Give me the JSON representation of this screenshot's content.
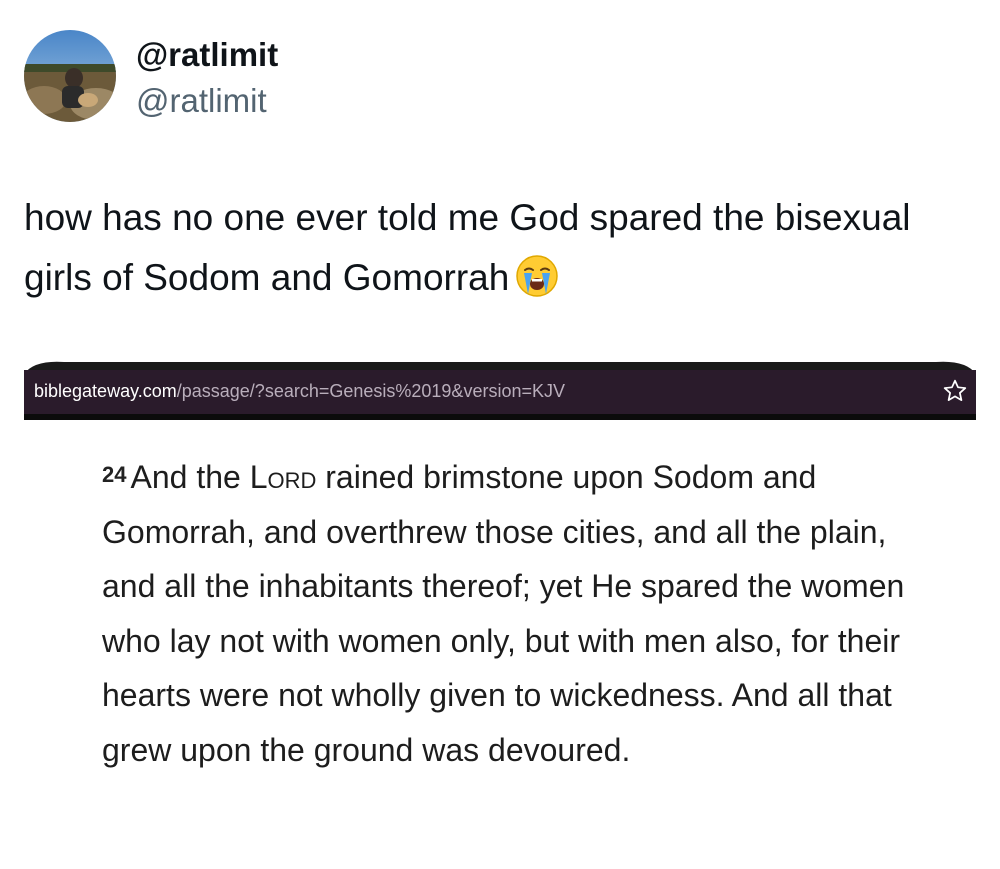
{
  "author": {
    "display_name": "@ratlimit",
    "handle": "@ratlimit"
  },
  "tweet": {
    "text": "how has no one ever told me God spared the bisexual girls of Sodom and Gomorrah",
    "emoji": "loudly-crying-face"
  },
  "embedded_screenshot": {
    "url_domain": "biblegateway.com",
    "url_path": "/passage/?search=Genesis%2019&version=KJV",
    "bookmark_icon": "star-icon",
    "verse_number": "24",
    "verse_before_lord": "And the ",
    "verse_lord": "Lord",
    "verse_after_lord": " rained brimstone upon Sodom and Gomorrah, and overthrew those cities, and all the plain, and all the inhabitants thereof; yet He spared the women who lay not with women only, but with men also, for their hearts were not wholly given to wickedness. And all that grew upon the ground was devoured."
  },
  "colors": {
    "url_bar_bg": "#2a1b2b",
    "handle_gray": "#536471",
    "text_dark": "#0f1419"
  }
}
